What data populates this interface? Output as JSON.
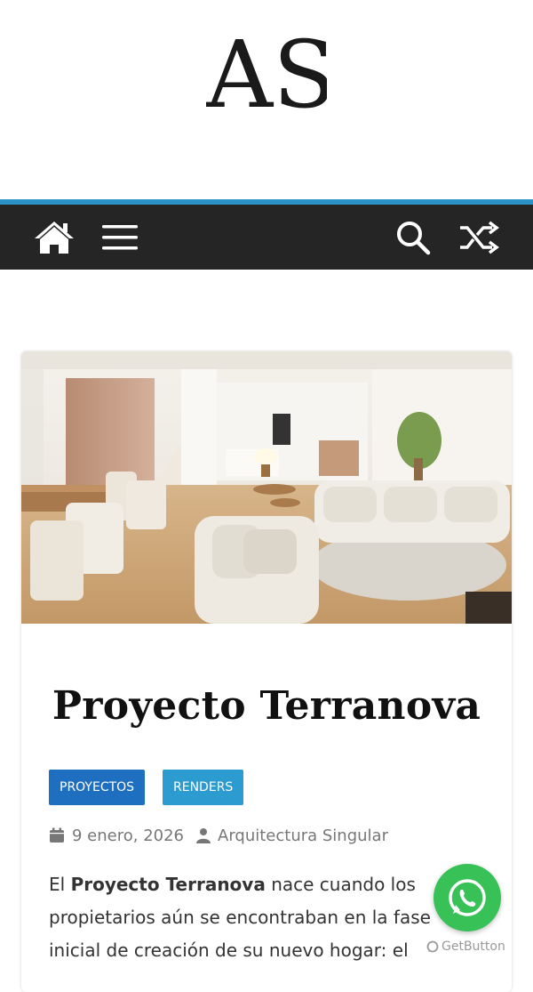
{
  "logo": {
    "text": "AS"
  },
  "nav": {
    "home_icon": "home-icon",
    "menu_icon": "hamburger-menu-icon",
    "search_icon": "search-icon",
    "shuffle_icon": "shuffle-icon"
  },
  "colors": {
    "accent_line": "#2b92c8",
    "navbar": "#252525",
    "tag_proyectos": "#1f6fc0",
    "tag_renders": "#2b9bd0",
    "whatsapp": "#37c157"
  },
  "post": {
    "title": "Proyecto Terranova",
    "tags": [
      "PROYECTOS",
      "RENDERS"
    ],
    "date": "9 enero, 2026",
    "author": "Arquitectura Singular",
    "excerpt_prefix": "El ",
    "excerpt_bold": "Proyecto Terranova",
    "excerpt_line1_rest": " nace cuando los",
    "excerpt_line2": "propietarios aún se encontraban en la fase",
    "excerpt_line3": "inicial de creación de su nuevo hogar: el"
  },
  "widget": {
    "label": "GetButton"
  }
}
